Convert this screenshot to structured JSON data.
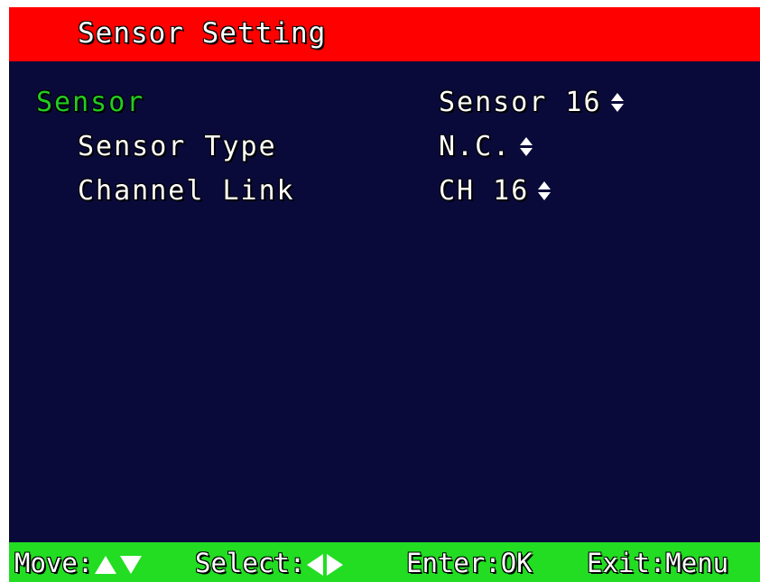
{
  "title": "Sensor Setting",
  "menu": {
    "sensor": {
      "label": "Sensor",
      "value": "Sensor 16"
    },
    "sensor_type": {
      "label": "Sensor Type",
      "value": "N.C."
    },
    "channel_link": {
      "label": "Channel Link",
      "value": "CH 16"
    }
  },
  "help": {
    "move_label": "Move:",
    "select_label": "Select:",
    "enter": "Enter:OK",
    "exit": "Exit:Menu"
  },
  "colors": {
    "title_bar": "#ff0000",
    "background": "#0a0a3a",
    "selected": "#22cc22",
    "help_bar": "#22dd22",
    "text": "#ffffff"
  },
  "icons": {
    "value_spinner": "up-down-arrows-icon",
    "move_keys": [
      "up-arrow-icon",
      "down-arrow-icon"
    ],
    "select_keys": [
      "left-arrow-icon",
      "right-arrow-icon"
    ]
  }
}
